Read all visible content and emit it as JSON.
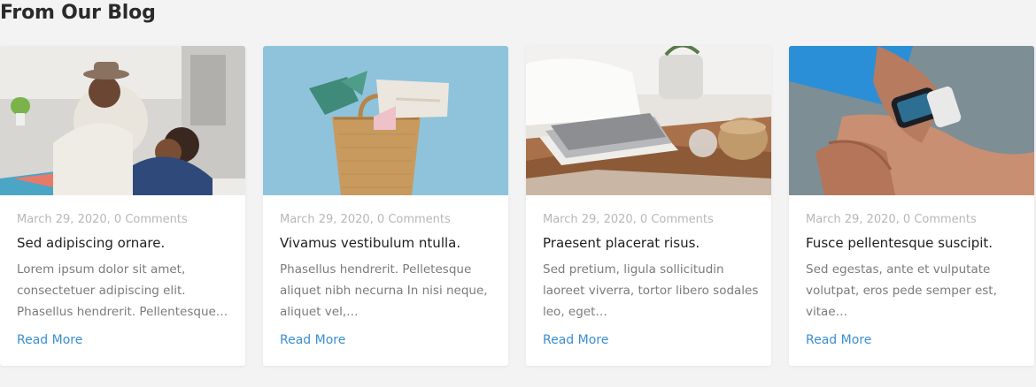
{
  "section": {
    "title": "From Our Blog"
  },
  "posts": [
    {
      "meta": "March 29, 2020, 0 Comments",
      "title": "Sed adipiscing ornare.",
      "excerpt": "Lorem ipsum dolor sit amet, consectetuer adipiscing elit. Phasellus hendrerit. Pellentesque…",
      "read_more": "Read More"
    },
    {
      "meta": "March 29, 2020, 0 Comments",
      "title": "Vivamus vestibulum ntulla.",
      "excerpt": "Phasellus hendrerit. Pelletesque aliquet nibh necurna In nisi neque, aliquet vel,…",
      "read_more": "Read More"
    },
    {
      "meta": "March 29, 2020, 0 Comments",
      "title": "Praesent placerat risus.",
      "excerpt": "Sed pretium, ligula sollicitudin laoreet viverra, tortor libero sodales leo, eget…",
      "read_more": "Read More"
    },
    {
      "meta": "March 29, 2020, 0 Comments",
      "title": "Fusce pellentesque suscipit.",
      "excerpt": "Sed egestas, ante et vulputate volutpat, eros pede semper est, vitae…",
      "read_more": "Read More"
    }
  ],
  "colors": {
    "accent_link": "#3a8fd1",
    "meta_text": "#b7b7b7",
    "body_text": "#7b7b7b",
    "page_background": "#f3f3f3"
  }
}
